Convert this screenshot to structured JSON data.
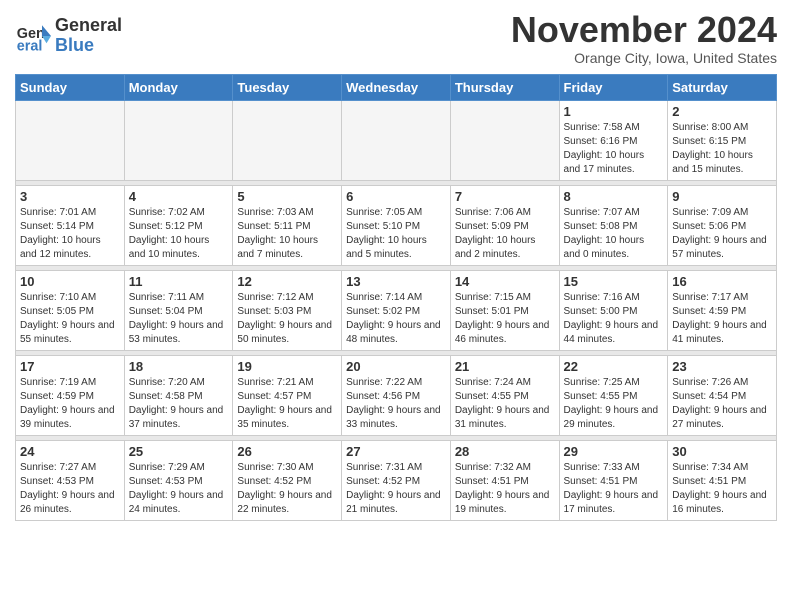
{
  "header": {
    "logo_general": "General",
    "logo_blue": "Blue",
    "month_title": "November 2024",
    "location": "Orange City, Iowa, United States"
  },
  "days_of_week": [
    "Sunday",
    "Monday",
    "Tuesday",
    "Wednesday",
    "Thursday",
    "Friday",
    "Saturday"
  ],
  "weeks": [
    [
      {
        "day": "",
        "empty": true
      },
      {
        "day": "",
        "empty": true
      },
      {
        "day": "",
        "empty": true
      },
      {
        "day": "",
        "empty": true
      },
      {
        "day": "",
        "empty": true
      },
      {
        "day": "1",
        "sunrise": "7:58 AM",
        "sunset": "6:16 PM",
        "daylight": "10 hours and 17 minutes."
      },
      {
        "day": "2",
        "sunrise": "8:00 AM",
        "sunset": "6:15 PM",
        "daylight": "10 hours and 15 minutes."
      }
    ],
    [
      {
        "day": "3",
        "sunrise": "7:01 AM",
        "sunset": "5:14 PM",
        "daylight": "10 hours and 12 minutes."
      },
      {
        "day": "4",
        "sunrise": "7:02 AM",
        "sunset": "5:12 PM",
        "daylight": "10 hours and 10 minutes."
      },
      {
        "day": "5",
        "sunrise": "7:03 AM",
        "sunset": "5:11 PM",
        "daylight": "10 hours and 7 minutes."
      },
      {
        "day": "6",
        "sunrise": "7:05 AM",
        "sunset": "5:10 PM",
        "daylight": "10 hours and 5 minutes."
      },
      {
        "day": "7",
        "sunrise": "7:06 AM",
        "sunset": "5:09 PM",
        "daylight": "10 hours and 2 minutes."
      },
      {
        "day": "8",
        "sunrise": "7:07 AM",
        "sunset": "5:08 PM",
        "daylight": "10 hours and 0 minutes."
      },
      {
        "day": "9",
        "sunrise": "7:09 AM",
        "sunset": "5:06 PM",
        "daylight": "9 hours and 57 minutes."
      }
    ],
    [
      {
        "day": "10",
        "sunrise": "7:10 AM",
        "sunset": "5:05 PM",
        "daylight": "9 hours and 55 minutes."
      },
      {
        "day": "11",
        "sunrise": "7:11 AM",
        "sunset": "5:04 PM",
        "daylight": "9 hours and 53 minutes."
      },
      {
        "day": "12",
        "sunrise": "7:12 AM",
        "sunset": "5:03 PM",
        "daylight": "9 hours and 50 minutes."
      },
      {
        "day": "13",
        "sunrise": "7:14 AM",
        "sunset": "5:02 PM",
        "daylight": "9 hours and 48 minutes."
      },
      {
        "day": "14",
        "sunrise": "7:15 AM",
        "sunset": "5:01 PM",
        "daylight": "9 hours and 46 minutes."
      },
      {
        "day": "15",
        "sunrise": "7:16 AM",
        "sunset": "5:00 PM",
        "daylight": "9 hours and 44 minutes."
      },
      {
        "day": "16",
        "sunrise": "7:17 AM",
        "sunset": "4:59 PM",
        "daylight": "9 hours and 41 minutes."
      }
    ],
    [
      {
        "day": "17",
        "sunrise": "7:19 AM",
        "sunset": "4:59 PM",
        "daylight": "9 hours and 39 minutes."
      },
      {
        "day": "18",
        "sunrise": "7:20 AM",
        "sunset": "4:58 PM",
        "daylight": "9 hours and 37 minutes."
      },
      {
        "day": "19",
        "sunrise": "7:21 AM",
        "sunset": "4:57 PM",
        "daylight": "9 hours and 35 minutes."
      },
      {
        "day": "20",
        "sunrise": "7:22 AM",
        "sunset": "4:56 PM",
        "daylight": "9 hours and 33 minutes."
      },
      {
        "day": "21",
        "sunrise": "7:24 AM",
        "sunset": "4:55 PM",
        "daylight": "9 hours and 31 minutes."
      },
      {
        "day": "22",
        "sunrise": "7:25 AM",
        "sunset": "4:55 PM",
        "daylight": "9 hours and 29 minutes."
      },
      {
        "day": "23",
        "sunrise": "7:26 AM",
        "sunset": "4:54 PM",
        "daylight": "9 hours and 27 minutes."
      }
    ],
    [
      {
        "day": "24",
        "sunrise": "7:27 AM",
        "sunset": "4:53 PM",
        "daylight": "9 hours and 26 minutes."
      },
      {
        "day": "25",
        "sunrise": "7:29 AM",
        "sunset": "4:53 PM",
        "daylight": "9 hours and 24 minutes."
      },
      {
        "day": "26",
        "sunrise": "7:30 AM",
        "sunset": "4:52 PM",
        "daylight": "9 hours and 22 minutes."
      },
      {
        "day": "27",
        "sunrise": "7:31 AM",
        "sunset": "4:52 PM",
        "daylight": "9 hours and 21 minutes."
      },
      {
        "day": "28",
        "sunrise": "7:32 AM",
        "sunset": "4:51 PM",
        "daylight": "9 hours and 19 minutes."
      },
      {
        "day": "29",
        "sunrise": "7:33 AM",
        "sunset": "4:51 PM",
        "daylight": "9 hours and 17 minutes."
      },
      {
        "day": "30",
        "sunrise": "7:34 AM",
        "sunset": "4:51 PM",
        "daylight": "9 hours and 16 minutes."
      }
    ]
  ]
}
